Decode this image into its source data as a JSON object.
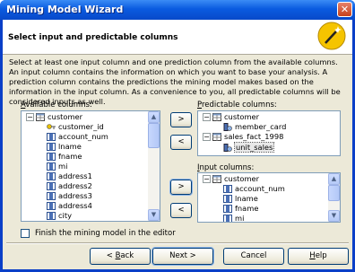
{
  "window": {
    "title": "Mining Model Wizard"
  },
  "header": {
    "title": "Select input and predictable columns"
  },
  "description": "Select at least one input column and one prediction column from the available columns. An input column contains the information on which you want to base your analysis. A prediction column contains the predictions the mining model makes based on the information in the input column. As a convenience to you, all predictable columns will be considered inputs as well.",
  "available": {
    "label_prefix": "",
    "label_access": "A",
    "label_rest": "vailable columns:",
    "table": "customer",
    "items": [
      "customer_id",
      "account_num",
      "lname",
      "fname",
      "mi",
      "address1",
      "address2",
      "address3",
      "address4",
      "city"
    ]
  },
  "predictable": {
    "label_access": "P",
    "label_rest": "redictable columns:",
    "groups": [
      {
        "table": "customer",
        "items": [
          "member_card"
        ]
      },
      {
        "table": "sales_fact_1998",
        "items": [
          "unit_sales"
        ]
      }
    ]
  },
  "input": {
    "label_access": "I",
    "label_rest": "nput columns:",
    "table": "customer",
    "items": [
      "account_num",
      "lname",
      "fname",
      "mi"
    ]
  },
  "move_buttons": {
    "add_predictable": ">",
    "remove_predictable": "<",
    "add_input": ">",
    "remove_input": "<"
  },
  "finish_checkbox": {
    "label": "Finish the mining model in the editor",
    "checked": false
  },
  "footer": {
    "back_access": "B",
    "back_rest": "ack",
    "back_prefix": "< ",
    "next": "Next >",
    "cancel": "Cancel",
    "help_access": "H",
    "help_rest": "elp"
  },
  "colors": {
    "title_bar": "#0a5be0",
    "dialog": "#ece9d8",
    "list_border": "#7f9db9"
  },
  "icons": {
    "close": "close-icon",
    "wizard": "magic-wand-icon",
    "table": "table-icon",
    "column": "column-icon",
    "key": "key-column-icon",
    "predict": "predict-column-icon"
  }
}
